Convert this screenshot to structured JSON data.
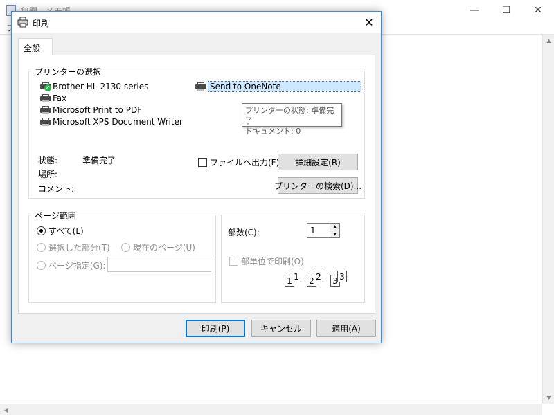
{
  "background_window": {
    "title": "無題 - メモ帳",
    "menu_partial": "ファ"
  },
  "dialog": {
    "title": "印刷",
    "tab_label": "全般",
    "printer_group_label": "プリンターの選択",
    "printers": [
      {
        "name": "Brother HL-2130 series",
        "default": true
      },
      {
        "name": "Fax"
      },
      {
        "name": "Microsoft Print to PDF"
      },
      {
        "name": "Microsoft XPS Document Writer"
      },
      {
        "name": "Send to OneNote",
        "selected": true
      }
    ],
    "tooltip": {
      "line1": "プリンターの状態: 準備完了",
      "line2": "ドキュメント: 0"
    },
    "status_label": "状態:",
    "status_value": "準備完了",
    "location_label": "場所:",
    "comment_label": "コメント:",
    "print_to_file_label": "ファイルへ出力(F)",
    "preferences_button": "詳細設定(R)",
    "find_printer_button": "プリンターの検索(D)...",
    "page_range_label": "ページ範囲",
    "range_all": "すべて(L)",
    "range_selection": "選択した部分(T)",
    "range_current": "現在のページ(U)",
    "range_pages": "ページ指定(G):",
    "copies_label": "部数(C):",
    "copies_value": "1",
    "collate_label": "部単位で印刷(O)",
    "collate_pages": [
      "1",
      "1",
      "2",
      "2",
      "3",
      "3"
    ],
    "print_button": "印刷(P)",
    "cancel_button": "キャンセル",
    "apply_button": "適用(A)"
  }
}
